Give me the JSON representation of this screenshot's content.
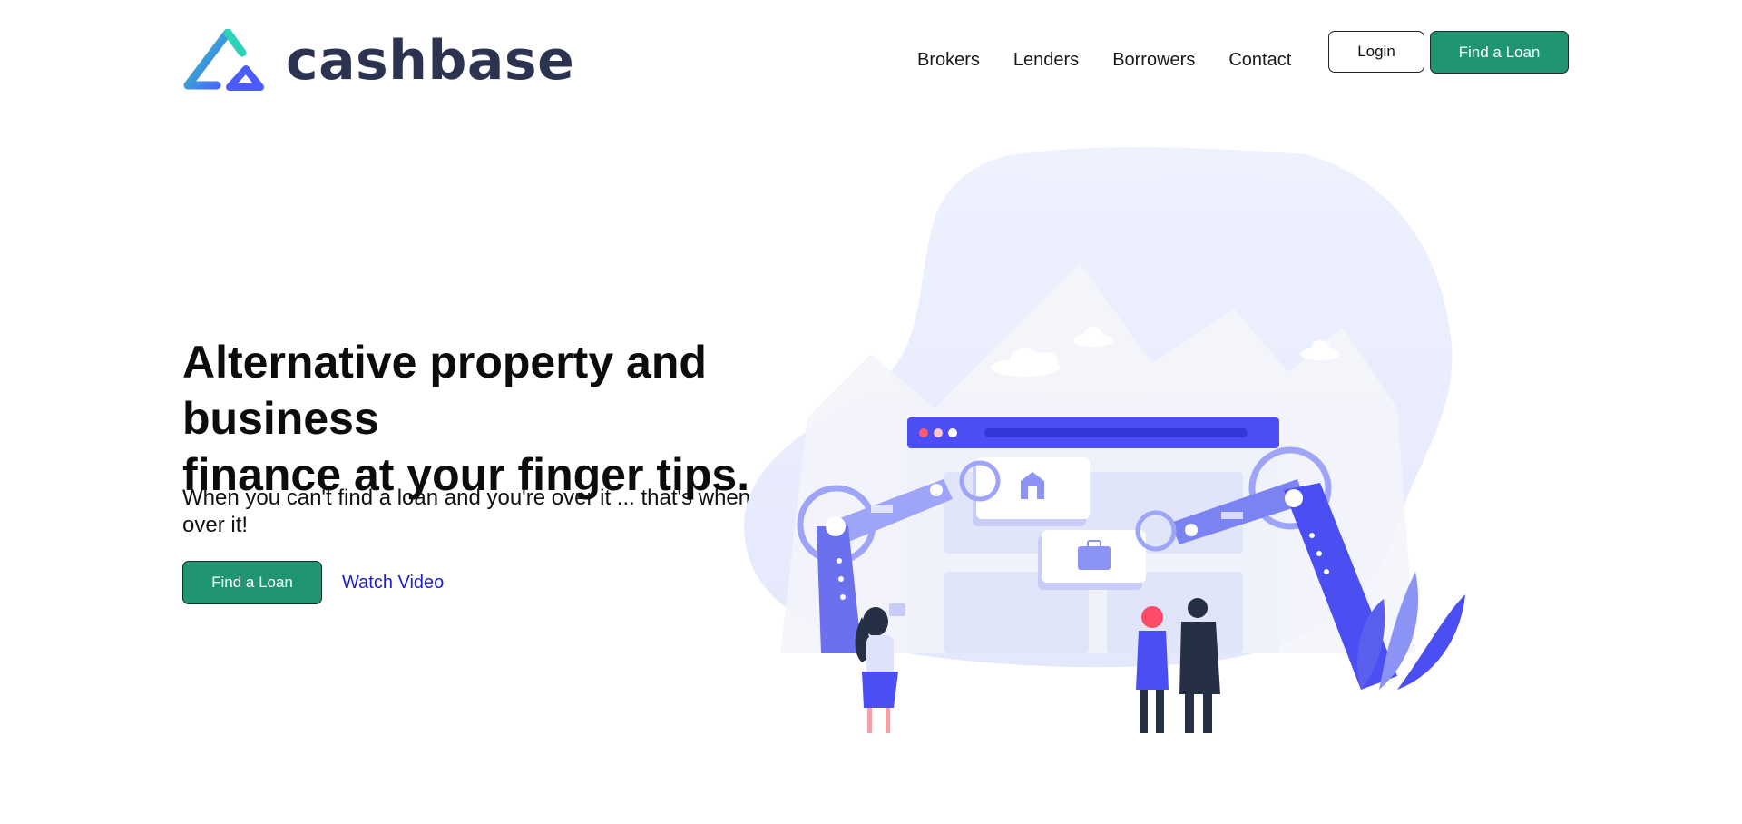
{
  "brand": {
    "name": "cashbase",
    "logo_colors": [
      "#2ed3b7",
      "#4b5cff"
    ],
    "text_color": "#2b3350"
  },
  "nav": {
    "items": [
      "Brokers",
      "Lenders",
      "Borrowers",
      "Contact"
    ],
    "login_label": "Login",
    "find_loan_label": "Find a Loan"
  },
  "hero": {
    "title_line1": "Alternative property and business",
    "title_line2": "finance at your finger tips.",
    "subtitle": "When you can't find a loan and you're over it ... that's when we're all over it!",
    "cta_label": "Find a Loan",
    "video_label": "Watch Video"
  },
  "illustration": {
    "description_icons": [
      "robot-arm-left",
      "robot-arm-right",
      "browser-window",
      "house-card",
      "briefcase-card",
      "woman-figure",
      "couple-figures",
      "plant"
    ],
    "colors": {
      "accent": "#4b4ef2",
      "soft": "#e8ecfd",
      "mid": "#7b82f2",
      "dark_figure": "#263045",
      "brand_green": "#1f9571"
    }
  }
}
